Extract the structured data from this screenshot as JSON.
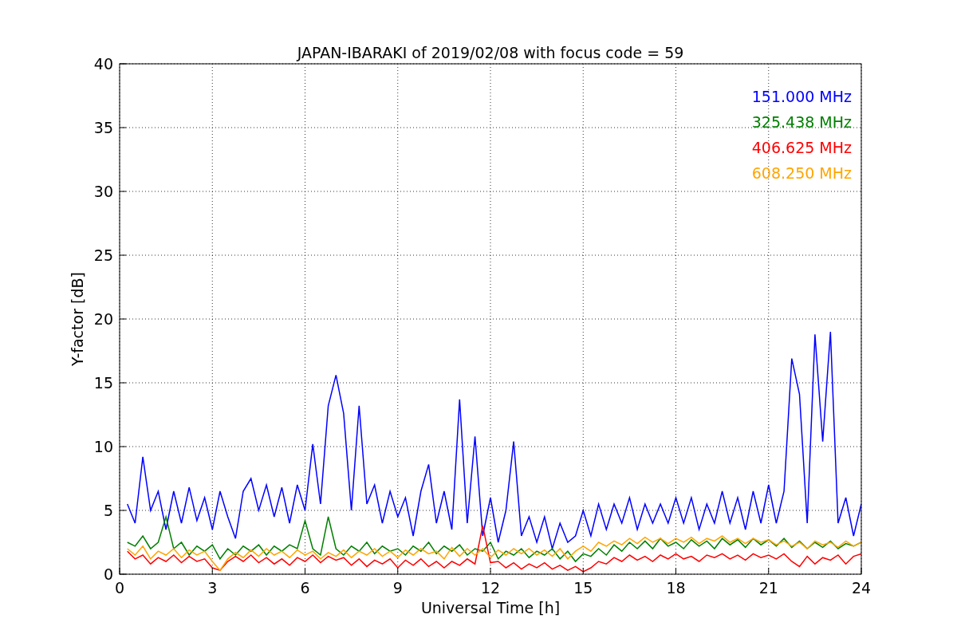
{
  "chart_data": {
    "type": "line",
    "title": "JAPAN-IBARAKI of 2019/02/08 with focus code = 59",
    "xlabel": "Universal Time [h]",
    "ylabel": "Y-factor [dB]",
    "xlim": [
      0,
      24
    ],
    "ylim": [
      0,
      40
    ],
    "grid": true,
    "xticks": [
      0,
      3,
      6,
      9,
      12,
      15,
      18,
      21,
      24
    ],
    "yticks": [
      0,
      5,
      10,
      15,
      20,
      25,
      30,
      35,
      40
    ],
    "x": [
      0.25,
      0.5,
      0.75,
      1,
      1.25,
      1.5,
      1.75,
      2,
      2.25,
      2.5,
      2.75,
      3,
      3.25,
      3.5,
      3.75,
      4,
      4.25,
      4.5,
      4.75,
      5,
      5.25,
      5.5,
      5.75,
      6,
      6.25,
      6.5,
      6.75,
      7,
      7.25,
      7.5,
      7.75,
      8,
      8.25,
      8.5,
      8.75,
      9,
      9.25,
      9.5,
      9.75,
      10,
      10.25,
      10.5,
      10.75,
      11,
      11.25,
      11.5,
      11.75,
      12,
      12.25,
      12.5,
      12.75,
      13,
      13.25,
      13.5,
      13.75,
      14,
      14.25,
      14.5,
      14.75,
      15,
      15.25,
      15.5,
      15.75,
      16,
      16.25,
      16.5,
      16.75,
      17,
      17.25,
      17.5,
      17.75,
      18,
      18.25,
      18.5,
      18.75,
      19,
      19.25,
      19.5,
      19.75,
      20,
      20.25,
      20.5,
      20.75,
      21,
      21.25,
      21.5,
      21.75,
      22,
      22.25,
      22.5,
      22.75,
      23,
      23.25,
      23.5,
      23.75,
      24
    ],
    "series": [
      {
        "name": "151.000 MHz",
        "color": "#0000ff",
        "values": [
          5.5,
          4,
          9.2,
          5,
          6.5,
          3.5,
          6.5,
          4,
          6.8,
          4.2,
          6,
          3.5,
          6.5,
          4.5,
          2.8,
          6.5,
          7.5,
          5,
          7,
          4.5,
          6.8,
          4,
          7,
          5,
          10.2,
          5.5,
          13.2,
          15.6,
          12.6,
          5,
          13.2,
          5.5,
          7,
          4,
          6.5,
          4.5,
          6,
          3,
          6.5,
          8.6,
          4,
          6.5,
          3.5,
          13.7,
          4,
          10.8,
          3,
          6,
          2.5,
          5,
          10.4,
          3,
          4.5,
          2.5,
          4.5,
          2,
          4,
          2.5,
          3,
          5,
          3,
          5.5,
          3.5,
          5.5,
          4,
          6,
          3.5,
          5.5,
          4,
          5.5,
          4,
          6,
          4,
          6,
          3.5,
          5.5,
          4,
          6.5,
          4,
          6,
          3.5,
          6.5,
          4,
          7,
          4,
          6.5,
          16.9,
          14.1,
          4,
          18.8,
          10.4,
          19,
          4,
          6,
          3,
          5.5
        ]
      },
      {
        "name": "325.438 MHz",
        "color": "#008000",
        "values": [
          2.5,
          2.2,
          3,
          2,
          2.5,
          4.5,
          2,
          2.5,
          1.5,
          2.2,
          1.8,
          2.3,
          1.2,
          2,
          1.5,
          2.2,
          1.8,
          2.3,
          1.5,
          2.2,
          1.8,
          2.3,
          2,
          4.2,
          2,
          1.5,
          4.5,
          2,
          1.5,
          2.2,
          1.8,
          2.5,
          1.6,
          2.2,
          1.8,
          2,
          1.5,
          2.2,
          1.8,
          2.5,
          1.6,
          2.2,
          1.8,
          2.3,
          1.5,
          2,
          1.8,
          2.5,
          1.2,
          1.8,
          1.5,
          2,
          1.3,
          1.8,
          1.5,
          2,
          1.2,
          1.8,
          1,
          1.6,
          1.4,
          2,
          1.5,
          2.3,
          1.8,
          2.5,
          2,
          2.6,
          2,
          2.8,
          2.2,
          2.5,
          2,
          2.7,
          2.2,
          2.6,
          2,
          2.8,
          2.3,
          2.7,
          2.1,
          2.8,
          2.3,
          2.7,
          2.2,
          2.8,
          2.1,
          2.6,
          2,
          2.5,
          2.1,
          2.6,
          2,
          2.4,
          2.2,
          2.5
        ]
      },
      {
        "name": "406.625 MHz",
        "color": "#ff0000",
        "values": [
          1.8,
          1.2,
          1.5,
          0.8,
          1.3,
          1,
          1.5,
          0.9,
          1.4,
          1,
          1.2,
          0.5,
          0.3,
          1,
          1.4,
          1,
          1.5,
          0.9,
          1.3,
          0.8,
          1.2,
          0.7,
          1.3,
          1,
          1.5,
          0.9,
          1.4,
          1.1,
          1.3,
          0.7,
          1.2,
          0.6,
          1.1,
          0.8,
          1.2,
          0.5,
          1.1,
          0.7,
          1.2,
          0.6,
          1,
          0.5,
          1,
          0.7,
          1.2,
          0.8,
          3.8,
          0.9,
          1,
          0.5,
          0.9,
          0.4,
          0.8,
          0.5,
          0.9,
          0.4,
          0.7,
          0.3,
          0.6,
          0.2,
          0.5,
          1,
          0.8,
          1.3,
          1,
          1.5,
          1.1,
          1.4,
          1,
          1.5,
          1.2,
          1.6,
          1.2,
          1.4,
          1,
          1.5,
          1.3,
          1.6,
          1.2,
          1.5,
          1.1,
          1.6,
          1.3,
          1.5,
          1.2,
          1.6,
          1,
          0.6,
          1.4,
          0.8,
          1.3,
          1.1,
          1.5,
          0.8,
          1.4,
          1.6
        ]
      },
      {
        "name": "608.250 MHz",
        "color": "#ffa500",
        "values": [
          2,
          1.5,
          2.2,
          1.2,
          1.8,
          1.5,
          2,
          1.3,
          1.9,
          1.5,
          1.8,
          1,
          0.3,
          1.2,
          1.7,
          1.3,
          1.9,
          1.4,
          2,
          1.5,
          1.8,
          1.3,
          1.9,
          1.5,
          1.8,
          1.2,
          1.7,
          1.4,
          1.9,
          1.3,
          1.8,
          1.5,
          2,
          1.4,
          1.8,
          1.3,
          1.9,
          1.5,
          2,
          1.6,
          1.8,
          1.2,
          2.1,
          1.4,
          2,
          1.5,
          2,
          1.3,
          1.9,
          1.5,
          2,
          1.6,
          2,
          1.5,
          1.9,
          1.4,
          2,
          1.2,
          1.8,
          2.2,
          1.8,
          2.5,
          2.2,
          2.6,
          2.3,
          2.8,
          2.4,
          2.9,
          2.5,
          2.8,
          2.4,
          2.8,
          2.5,
          2.9,
          2.4,
          2.8,
          2.6,
          3,
          2.5,
          2.8,
          2.4,
          2.8,
          2.5,
          2.7,
          2.3,
          2.6,
          2.2,
          2.5,
          2,
          2.6,
          2.3,
          2.5,
          2.1,
          2.6,
          2.2,
          2.5
        ]
      }
    ]
  }
}
